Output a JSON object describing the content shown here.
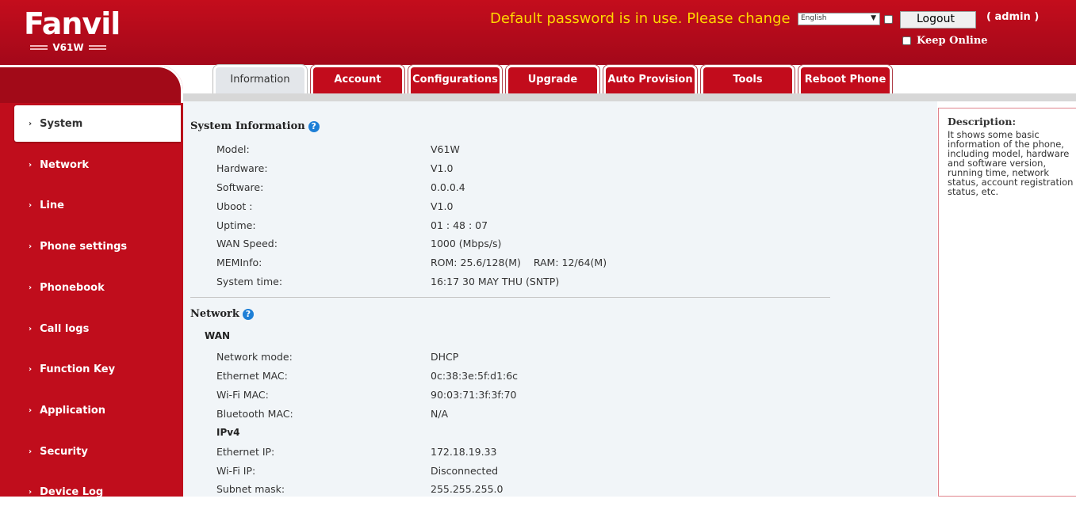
{
  "header": {
    "logo": "Fanvil",
    "model": "V61W",
    "warning": "Default password is in use. Please change",
    "language": "English",
    "logout_label": "Logout",
    "user_label": "( admin )",
    "keep_online_label": "Keep Online"
  },
  "tabs": [
    {
      "label": "Information",
      "active": true
    },
    {
      "label": "Account"
    },
    {
      "label": "Configurations"
    },
    {
      "label": "Upgrade"
    },
    {
      "label": "Auto Provision"
    },
    {
      "label": "Tools"
    },
    {
      "label": "Reboot Phone"
    }
  ],
  "sidebar": {
    "items": [
      {
        "label": "System",
        "active": true
      },
      {
        "label": "Network"
      },
      {
        "label": "Line"
      },
      {
        "label": "Phone settings"
      },
      {
        "label": "Phonebook"
      },
      {
        "label": "Call logs"
      },
      {
        "label": "Function Key"
      },
      {
        "label": "Application"
      },
      {
        "label": "Security"
      },
      {
        "label": "Device Log"
      }
    ]
  },
  "system_info": {
    "title": "System Information",
    "rows": [
      {
        "label": "Model:",
        "value": "V61W"
      },
      {
        "label": "Hardware:",
        "value": "V1.0"
      },
      {
        "label": "Software:",
        "value": "0.0.0.4"
      },
      {
        "label": "Uboot :",
        "value": "V1.0"
      },
      {
        "label": "Uptime:",
        "value": "01 : 48 : 07"
      },
      {
        "label": "WAN Speed:",
        "value": "1000 (Mbps/s)"
      },
      {
        "label": "MEMInfo:",
        "value": "ROM: 25.6/128(M)    RAM: 12/64(M)"
      },
      {
        "label": "System time:",
        "value": "16:17 30 MAY THU (SNTP)"
      }
    ]
  },
  "network": {
    "title": "Network",
    "wan_label": "WAN",
    "wan_rows": [
      {
        "label": "Network mode:",
        "value": "DHCP"
      },
      {
        "label": "Ethernet MAC:",
        "value": "0c:38:3e:5f:d1:6c"
      },
      {
        "label": "Wi-Fi MAC:",
        "value": "90:03:71:3f:3f:70"
      },
      {
        "label": "Bluetooth MAC:",
        "value": "N/A"
      }
    ],
    "ipv4_label": "IPv4",
    "ipv4_rows": [
      {
        "label": "Ethernet IP:",
        "value": "172.18.19.33"
      },
      {
        "label": "Wi-Fi IP:",
        "value": "Disconnected"
      },
      {
        "label": "Subnet mask:",
        "value": "255.255.255.0"
      }
    ]
  },
  "description": {
    "title": "Description:",
    "text": "It shows some basic information of the phone, including model, hardware and software version, running time, network status, account registration status, etc."
  },
  "colors": {
    "brand_red": "#c20c1c",
    "warning_yellow": "#ffd700",
    "help_blue": "#1e7fd6"
  }
}
